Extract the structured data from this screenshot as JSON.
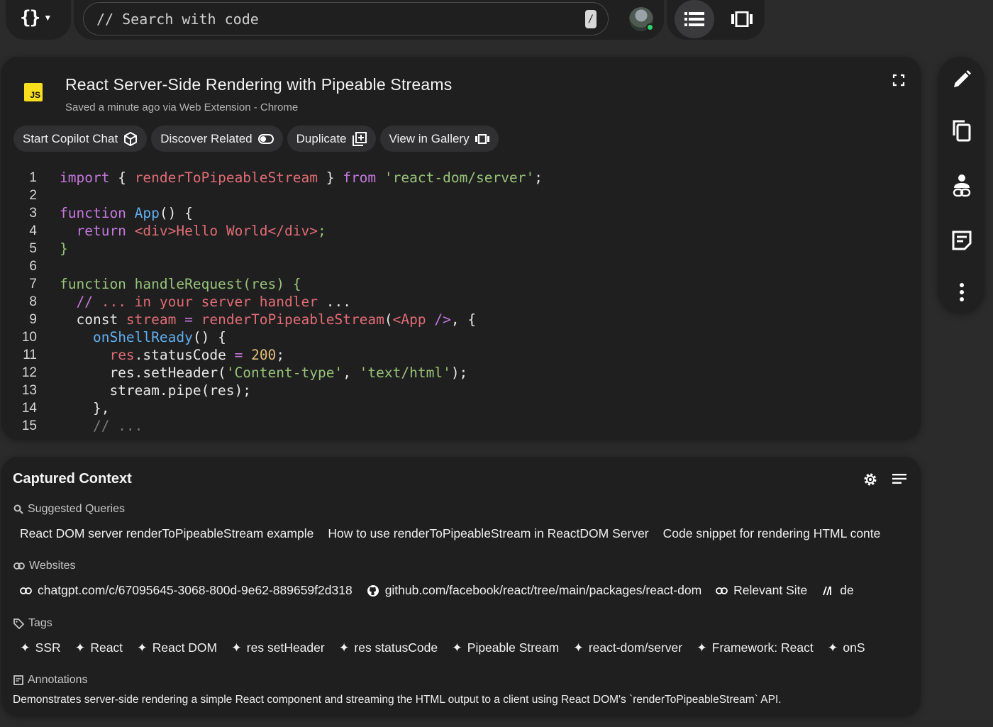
{
  "topbar": {
    "logo_glyph": "{}",
    "search_placeholder": "// Search with code",
    "search_shortcut": "/"
  },
  "snippet": {
    "language_badge": "JS",
    "title": "React Server-Side Rendering with Pipeable Streams",
    "subtitle": "Saved a minute ago via Web Extension - Chrome",
    "actions": [
      {
        "label": "Start Copilot Chat",
        "icon": "copilot-icon"
      },
      {
        "label": "Discover Related",
        "icon": "toggle-icon"
      },
      {
        "label": "Duplicate",
        "icon": "duplicate-icon"
      },
      {
        "label": "View in Gallery",
        "icon": "gallery-icon"
      }
    ],
    "line_numbers": [
      "1",
      "2",
      "3",
      "4",
      "5",
      "6",
      "7",
      "8",
      "9",
      "10",
      "11",
      "12",
      "13",
      "14",
      "15"
    ],
    "code_lines": [
      "import { renderToPipeableStream } from 'react-dom/server';",
      "",
      "function App() {",
      "  return <div>Hello World</div>;",
      "}",
      "",
      "function handleRequest(res) {",
      "  // ... in your server handler ...",
      "  const stream = renderToPipeableStream(<App />, {",
      "    onShellReady() {",
      "      res.statusCode = 200;",
      "      res.setHeader('Content-type', 'text/html');",
      "      stream.pipe(res);",
      "    },",
      "    // ..."
    ]
  },
  "context": {
    "title": "Captured Context",
    "suggested_label": "Suggested Queries",
    "suggested_queries": [
      "React DOM server renderToPipeableStream example",
      "How to use renderToPipeableStream in ReactDOM Server",
      "Code snippet for rendering HTML conte"
    ],
    "websites_label": "Websites",
    "websites": [
      {
        "label": "chatgpt.com/c/67095645-3068-800d-9e62-889659f2d318",
        "icon": "link-icon"
      },
      {
        "label": "github.com/facebook/react/tree/main/packages/react-dom",
        "icon": "github-icon"
      },
      {
        "label": "Relevant Site",
        "icon": "link-icon"
      },
      {
        "label": "de",
        "icon": "mdn-icon"
      }
    ],
    "tags_label": "Tags",
    "tags": [
      "SSR",
      "React",
      "React DOM",
      "res setHeader",
      "res statusCode",
      "Pipeable Stream",
      "react-dom/server",
      "Framework: React",
      "onS"
    ],
    "annotations_label": "Annotations",
    "annotation_text": "Demonstrates server-side rendering a simple React component and streaming the HTML output to a client using React DOM's `renderToPipeableStream` API."
  },
  "colors": {
    "background": "#2b2b2c",
    "card": "#1f1f20",
    "keyword": "#c678dd",
    "string": "#98c379",
    "identifier": "#e06c75",
    "function_blue": "#61afef",
    "number": "#e5c07b",
    "js_badge": "#f7df1e",
    "online_dot": "#2fd36b"
  }
}
